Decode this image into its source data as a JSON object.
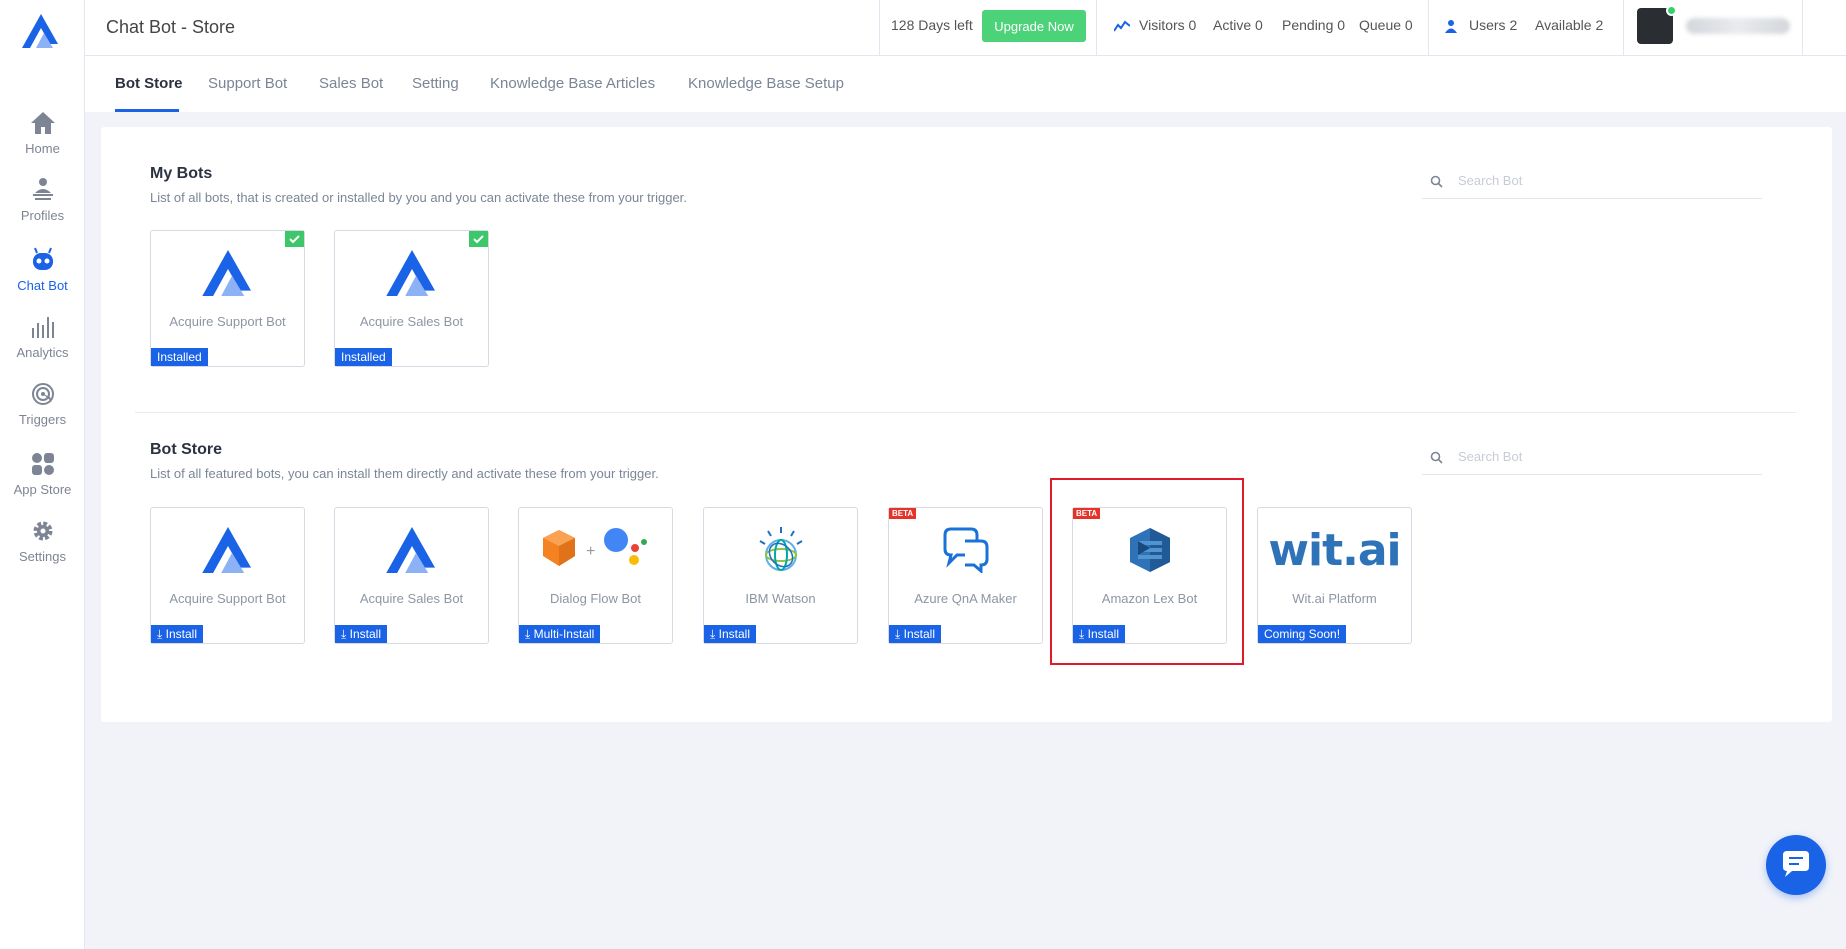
{
  "header": {
    "title": "Chat Bot - Store",
    "trial_text": "128 Days left",
    "upgrade_label": "Upgrade Now",
    "stats": {
      "visitors": "Visitors 0",
      "active": "Active 0",
      "pending": "Pending 0",
      "queue": "Queue 0",
      "users": "Users 2",
      "available": "Available 2"
    }
  },
  "sidebar": {
    "items": [
      {
        "label": "Home",
        "icon": "home-icon"
      },
      {
        "label": "Profiles",
        "icon": "profiles-icon"
      },
      {
        "label": "Chat Bot",
        "icon": "chatbot-icon",
        "active": true
      },
      {
        "label": "Analytics",
        "icon": "analytics-icon"
      },
      {
        "label": "Triggers",
        "icon": "triggers-icon"
      },
      {
        "label": "App Store",
        "icon": "app-store-icon"
      },
      {
        "label": "Settings",
        "icon": "gear-icon"
      }
    ]
  },
  "tabs": [
    {
      "label": "Bot Store",
      "active": true
    },
    {
      "label": "Support Bot"
    },
    {
      "label": "Sales Bot"
    },
    {
      "label": "Setting"
    },
    {
      "label": "Knowledge Base Articles"
    },
    {
      "label": "Knowledge Base Setup"
    }
  ],
  "my_bots": {
    "title": "My Bots",
    "description": "List of all bots, that is created or installed by you and you can activate these from your trigger.",
    "search_placeholder": "Search Bot",
    "bots": [
      {
        "name": "Acquire Support Bot",
        "badge": "Installed",
        "logo": "acquire-logo-icon"
      },
      {
        "name": "Acquire Sales Bot",
        "badge": "Installed",
        "logo": "acquire-logo-icon"
      }
    ]
  },
  "bot_store": {
    "title": "Bot Store",
    "description": "List of all featured bots, you can install them directly and activate these from your trigger.",
    "search_placeholder": "Search Bot",
    "bots": [
      {
        "name": "Acquire Support Bot",
        "badge": "Install",
        "logo": "acquire-logo-icon"
      },
      {
        "name": "Acquire Sales Bot",
        "badge": "Install",
        "logo": "acquire-logo-icon"
      },
      {
        "name": "Dialog Flow Bot",
        "badge": "Multi-Install",
        "logo": "dialogflow-logo-icon"
      },
      {
        "name": "IBM Watson",
        "badge": "Install",
        "logo": "ibm-watson-logo-icon"
      },
      {
        "name": "Azure QnA Maker",
        "badge": "Install",
        "logo": "azure-qna-logo-icon",
        "beta": "BETA"
      },
      {
        "name": "Amazon Lex Bot",
        "badge": "Install",
        "logo": "amazon-lex-logo-icon",
        "beta": "BETA",
        "highlighted": true
      },
      {
        "name": "Wit.ai Platform",
        "badge": "Coming Soon!",
        "logo": "wit-ai-logo-icon",
        "logo_text": "wit.ai"
      }
    ]
  },
  "colors": {
    "primary": "#1a62e6",
    "upgrade": "#4cd278",
    "installed_check": "#3ec66b",
    "beta": "#e5332a",
    "highlight": "#e3182a"
  }
}
